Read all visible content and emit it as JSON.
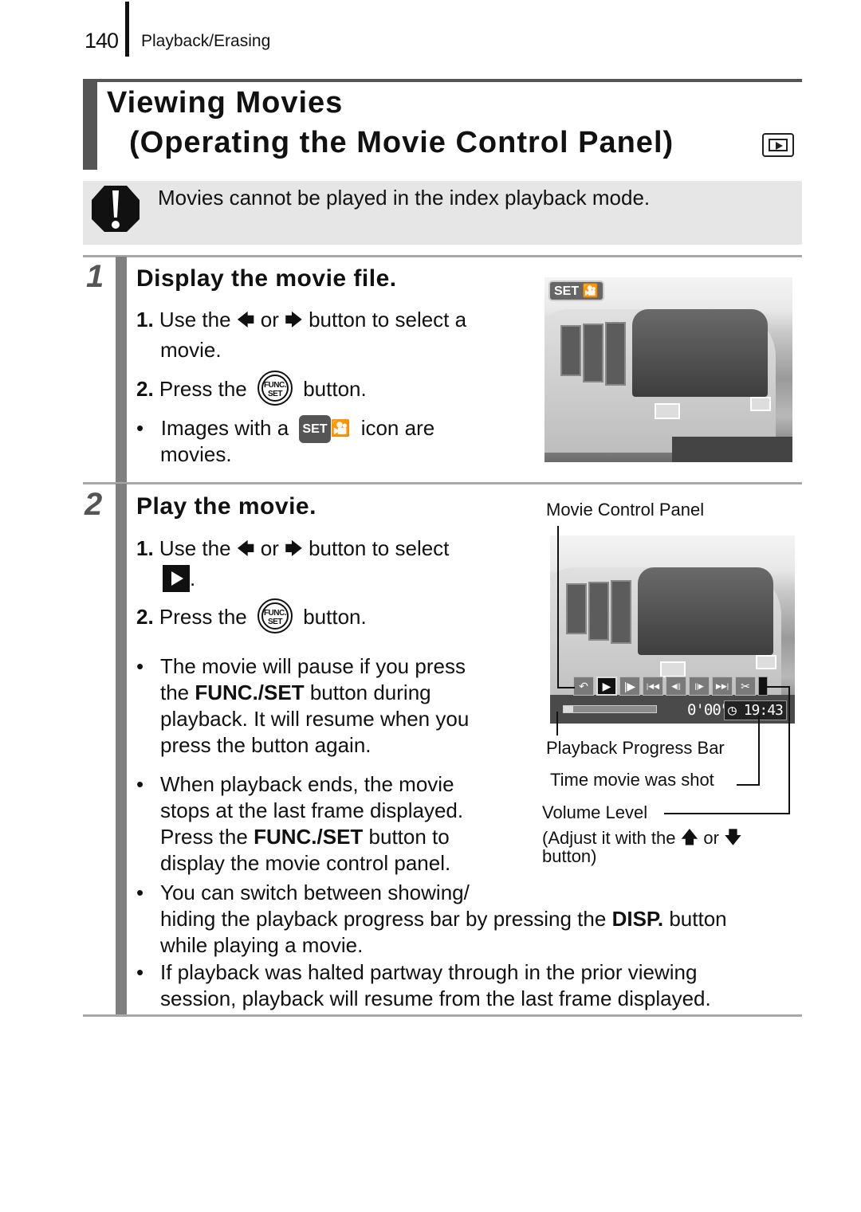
{
  "header": {
    "page_number": "140",
    "section": "Playback/Erasing"
  },
  "title": {
    "line1": "Viewing Movies",
    "line2": "(Operating the Movie Control Panel)",
    "mode_icon": "playback-mode-icon"
  },
  "caution": {
    "icon": "caution-icon",
    "text": "Movies cannot be played in the index playback mode."
  },
  "steps": [
    {
      "number": "1",
      "heading": "Display the movie file.",
      "instructions": [
        {
          "num": "1.",
          "pre": "Use the",
          "icon_left": "←",
          "mid": "or",
          "icon_right": "→",
          "post": "button to select a",
          "cont": "movie."
        },
        {
          "num": "2.",
          "pre": "Press the",
          "button_label_top": "FUNC.",
          "button_label_bottom": "SET",
          "post": "button."
        }
      ],
      "bullets": [
        {
          "pre": "Images with a",
          "badge": "SET",
          "post": "icon are",
          "cont": "movies."
        }
      ],
      "screen": {
        "overlay_badge": "SET",
        "overlay_icon": "movie-icon"
      }
    },
    {
      "number": "2",
      "heading": "Play the movie.",
      "instructions": [
        {
          "num": "1.",
          "pre": "Use the",
          "icon_left": "←",
          "mid": "or",
          "icon_right": "→",
          "post": "button to select",
          "cont": "."
        },
        {
          "num": "2.",
          "pre": "Press the",
          "button_label_top": "FUNC.",
          "button_label_bottom": "SET",
          "post": "button."
        }
      ],
      "bullets": [
        {
          "lines": [
            "The movie will pause if you press",
            "the |FUNC./SET| button during",
            "playback. It will resume when you",
            "press the button again."
          ]
        },
        {
          "lines": [
            "When playback ends, the movie",
            "stops at the last frame displayed.",
            "Press the |FUNC./SET| button to",
            "display the movie control panel."
          ]
        },
        {
          "lines": [
            "You can switch between showing/",
            "hiding the playback progress bar by pressing the |DISP.| button",
            "while playing a movie."
          ]
        },
        {
          "lines": [
            "If playback was halted partway through in the prior viewing",
            "session, playback will resume from the last frame displayed."
          ]
        }
      ],
      "control_panel": {
        "title": "Movie Control Panel",
        "buttons": [
          {
            "name": "exit",
            "glyph": "↶"
          },
          {
            "name": "play",
            "glyph": "▶",
            "active": true
          },
          {
            "name": "slow-motion",
            "glyph": "|▶"
          },
          {
            "name": "first-frame",
            "glyph": "|◀◀"
          },
          {
            "name": "previous-frame",
            "glyph": "◀||"
          },
          {
            "name": "next-frame",
            "glyph": "||▶"
          },
          {
            "name": "last-frame",
            "glyph": "▶▶|"
          },
          {
            "name": "edit",
            "glyph": "✂"
          }
        ],
        "progress": 0.1,
        "elapsed": "0'00\"",
        "time_shot": "19:43",
        "labels": {
          "progress_bar": "Playback Progress Bar",
          "time_shot": "Time movie was shot",
          "volume": "Volume Level",
          "volume_note_pre": "(Adjust it with the",
          "volume_note_up": "↑",
          "volume_note_or": "or",
          "volume_note_down": "↓",
          "volume_note_post": "button)"
        }
      }
    }
  ]
}
